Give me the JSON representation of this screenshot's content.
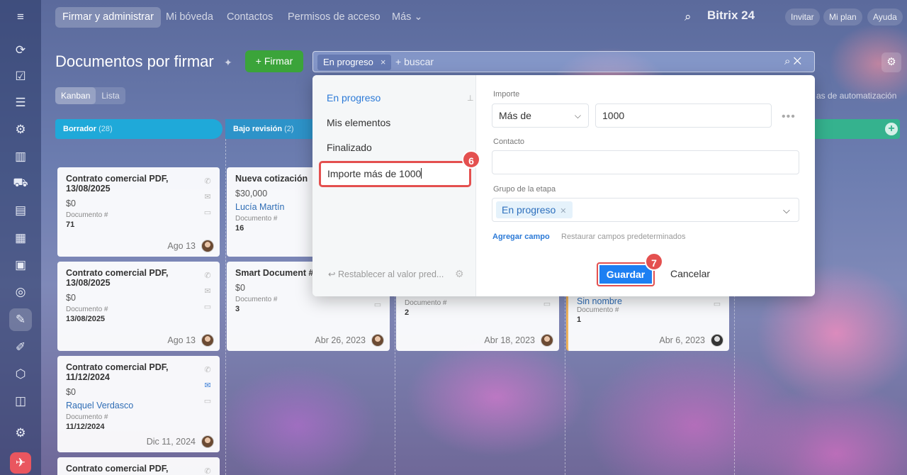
{
  "topbar": {
    "tabs": [
      "Firmar y administrar",
      "Mi bóveda",
      "Contactos",
      "Permisos de acceso",
      "Más ⌄"
    ],
    "brand": "Bitrix 24",
    "pills": [
      "Invitar",
      "Mi plan",
      "Ayuda"
    ]
  },
  "page": {
    "title": "Documentos por firmar",
    "firmar_button": "+ Firmar",
    "views": [
      "Kanban",
      "Lista"
    ],
    "automation": "as de automatización"
  },
  "columns": [
    {
      "name": "Borrador",
      "count": "(28)",
      "color": "#1fa9d9"
    },
    {
      "name": "Bajo revisión",
      "count": "(2)",
      "color": "#2d93c9"
    },
    {
      "name": "",
      "count": "",
      "color": "#35b28e"
    }
  ],
  "cards": [
    {
      "title": "Contrato comercial PDF, 13/08/2025",
      "amount": "$0",
      "person": "",
      "label": "Documento #",
      "value": "71",
      "date": "Ago 13"
    },
    {
      "title": "Contrato comercial PDF, 13/08/2025",
      "amount": "$0",
      "person": "",
      "label": "Documento #",
      "value": "13/08/2025",
      "date": "Ago 13"
    },
    {
      "title": "Contrato comercial PDF, 11/12/2024",
      "amount": "$0",
      "person": "Raquel Verdasco",
      "label": "Documento #",
      "value": "11/12/2024",
      "date": "Dic 11, 2024"
    },
    {
      "title": "Contrato comercial PDF,",
      "amount": "",
      "person": "",
      "label": "",
      "value": "",
      "date": ""
    },
    {
      "title": "Nueva cotización",
      "amount": "$30,000",
      "person": "Lucía Martín",
      "label": "Documento #",
      "value": "16",
      "date": ""
    },
    {
      "title": "Smart Document #",
      "amount": "$0",
      "person": "",
      "label": "Documento #",
      "value": "3",
      "date": "Abr 26, 2023"
    },
    {
      "title": "",
      "amount": "",
      "person": "",
      "label": "Documento #",
      "value": "2",
      "date": "Abr 18, 2023"
    },
    {
      "title": "",
      "amount": "",
      "person": "Sin nombre",
      "label": "Documento #",
      "value": "1",
      "date": "Abr 6, 2023"
    }
  ],
  "filter": {
    "chip": "En progreso",
    "placeholder": "+ buscar",
    "presets": [
      "En progreso",
      "Mis elementos",
      "Finalizado"
    ],
    "preset_input": "Importe más de 1000",
    "restore_defaults": "Restablecer al valor pred...",
    "amount_label": "Importe",
    "amount_operator": "Más de",
    "amount_value": "1000",
    "contact_label": "Contacto",
    "contact_value": "",
    "stage_label": "Grupo de la etapa",
    "stage_tag": "En progreso",
    "add_field": "Agregar campo",
    "restore_fields": "Restaurar campos predeterminados",
    "save": "Guardar",
    "cancel": "Cancelar"
  },
  "steps": [
    "6",
    "7"
  ]
}
